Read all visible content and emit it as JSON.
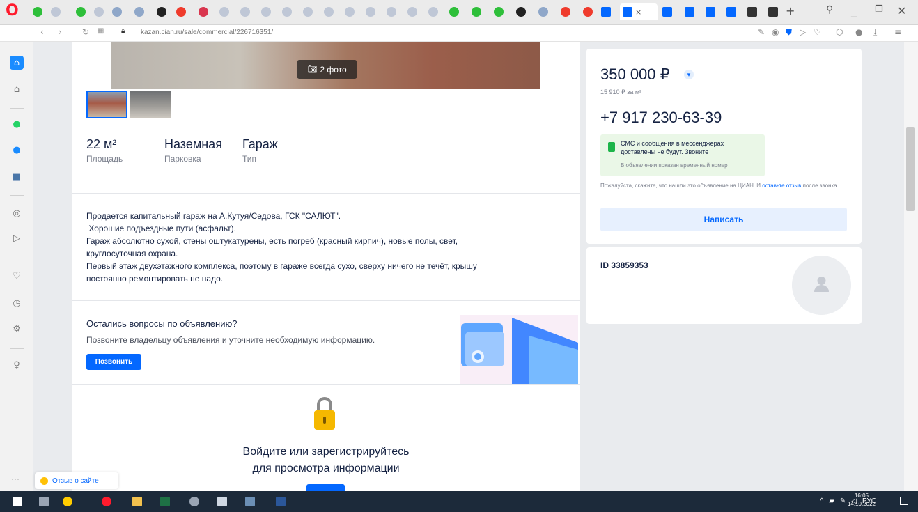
{
  "browser": {
    "url": "kazan.cian.ru/sale/commercial/226716351/"
  },
  "listing": {
    "photo_badge": "2 фото",
    "features": [
      {
        "value": "22 м²",
        "label": "Площадь"
      },
      {
        "value": "Наземная",
        "label": "Парковка"
      },
      {
        "value": "Гараж",
        "label": "Тип"
      }
    ],
    "description": [
      "Продается капитальный гараж на А.Кутуя/Седова, ГСК \"САЛЮТ\".",
      " Хорошие подъездные пути (асфальт).",
      "Гараж абсолютно сухой, стены оштукатурены, есть погреб (красный кирпич), новые полы, свет,",
      "круглосуточная охрана.",
      "Первый этаж двухэтажного комплекса, поэтому в гараже всегда сухо, сверху ничего не течёт, крышу",
      "постоянно ремонтировать не надо."
    ],
    "questions_title": "Остались вопросы по объявлению?",
    "questions_text": "Позвоните владельцу объявления и уточните необходимую информацию.",
    "call_button": "Позвонить",
    "login_title_1": "Войдите или зарегистрируйтесь",
    "login_title_2": "для просмотра информации"
  },
  "sidebar_card": {
    "price": "350 000 ₽",
    "price_per_m": "15 910 ₽ за м²",
    "phone": "+7 917 230-63-39",
    "sms_notice": "СМС и сообщения в мессенджерах доставлены не будут. Звоните",
    "sms_sub": "В объявлении показан временный номер",
    "please_text": "Пожалуйста, скажите, что нашли это объявление на ЦИАН. И ",
    "please_link": "оставьте отзыв",
    "please_tail": " после звонка",
    "write_button": "Написать",
    "ad_id": "ID 33859353"
  },
  "feedback_widget": {
    "label": "Отзыв о сайте"
  },
  "taskbar": {
    "lang": "РУС",
    "time": "16:05",
    "date": "14.10.2022"
  },
  "colors": {
    "accent": "#0468ff",
    "text": "#152242",
    "muted": "#7a7f8c"
  }
}
